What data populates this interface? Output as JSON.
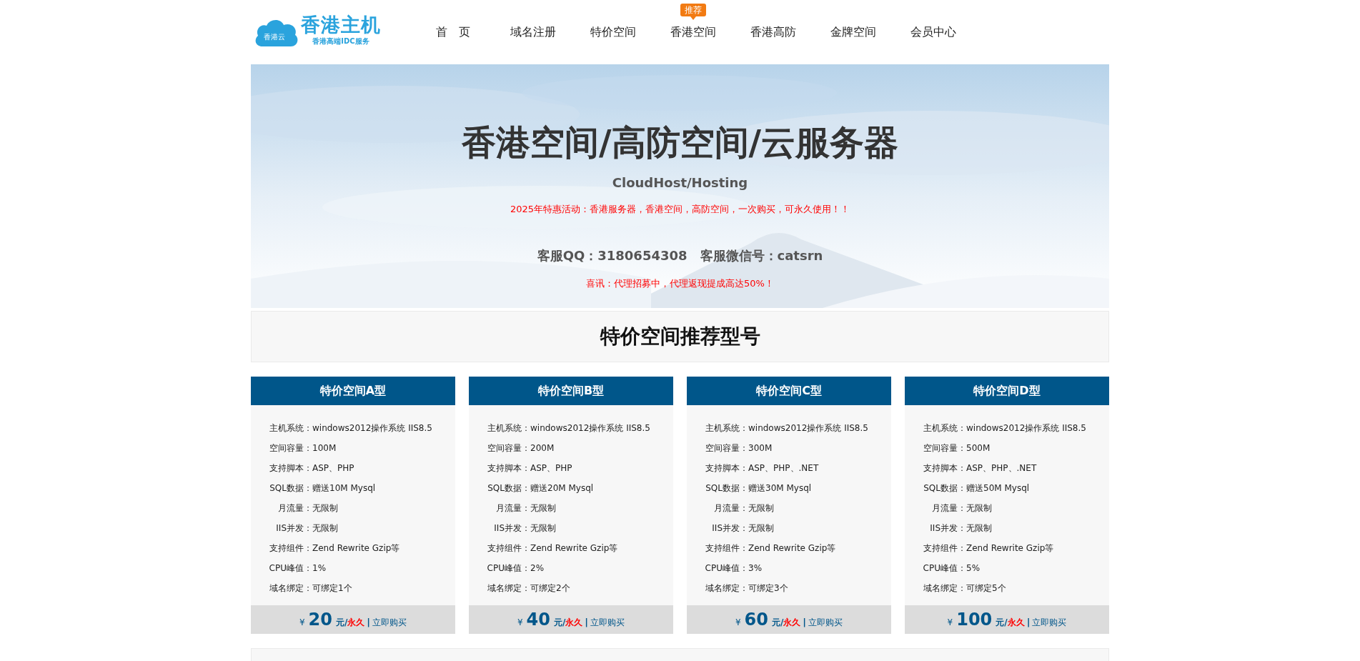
{
  "logo": {
    "badge": "香港云",
    "title": "香港主机",
    "subtitle": "香港高端IDC服务"
  },
  "nav": [
    {
      "label": "首　页"
    },
    {
      "label": "域名注册"
    },
    {
      "label": "特价空间"
    },
    {
      "label": "香港空间",
      "badge": "推荐"
    },
    {
      "label": "香港高防"
    },
    {
      "label": "金牌空间"
    },
    {
      "label": "会员中心"
    }
  ],
  "banner": {
    "title": "香港空间/高防空间/云服务器",
    "subtitle": "CloudHost/Hosting",
    "promo": "2025年特惠活动：香港服务器，香港空间，高防空间，一次购买，可永久使用！！",
    "contact": "客服QQ：3180654308　客服微信号：catsrn",
    "notice": "喜讯：代理招募中，代理返现提成高达50%！"
  },
  "section": {
    "title": "特价空间推荐型号"
  },
  "plans": [
    {
      "name": "特价空间A型",
      "specs": [
        {
          "label": "主机系统：",
          "value": "windows2012操作系统 IIS8.5"
        },
        {
          "label": "空间容量：",
          "value": "100M"
        },
        {
          "label": "支持脚本：",
          "value": "ASP、PHP"
        },
        {
          "label": "SQL数据：",
          "value": "赠送10M Mysql"
        },
        {
          "label": "月流量：",
          "value": "无限制"
        },
        {
          "label": "IIS并发：",
          "value": "无限制"
        },
        {
          "label": "支持组件：",
          "value": "Zend Rewrite Gzip等"
        },
        {
          "label": "CPU峰值：",
          "value": "1%"
        },
        {
          "label": "域名绑定：",
          "value": "可绑定1个"
        }
      ],
      "price": {
        "currency": "¥",
        "amount": "20",
        "unit": "元/",
        "term": "永久",
        "separator": "|",
        "buy": "立即购买"
      }
    },
    {
      "name": "特价空间B型",
      "specs": [
        {
          "label": "主机系统：",
          "value": "windows2012操作系统 IIS8.5"
        },
        {
          "label": "空间容量：",
          "value": "200M"
        },
        {
          "label": "支持脚本：",
          "value": "ASP、PHP"
        },
        {
          "label": "SQL数据：",
          "value": "赠送20M Mysql"
        },
        {
          "label": "月流量：",
          "value": "无限制"
        },
        {
          "label": "IIS并发：",
          "value": "无限制"
        },
        {
          "label": "支持组件：",
          "value": "Zend Rewrite Gzip等"
        },
        {
          "label": "CPU峰值：",
          "value": "2%"
        },
        {
          "label": "域名绑定：",
          "value": "可绑定2个"
        }
      ],
      "price": {
        "currency": "¥",
        "amount": "40",
        "unit": "元/",
        "term": "永久",
        "separator": "|",
        "buy": "立即购买"
      }
    },
    {
      "name": "特价空间C型",
      "specs": [
        {
          "label": "主机系统：",
          "value": "windows2012操作系统 IIS8.5"
        },
        {
          "label": "空间容量：",
          "value": "300M"
        },
        {
          "label": "支持脚本：",
          "value": "ASP、PHP、.NET"
        },
        {
          "label": "SQL数据：",
          "value": "赠送30M Mysql"
        },
        {
          "label": "月流量：",
          "value": "无限制"
        },
        {
          "label": "IIS并发：",
          "value": "无限制"
        },
        {
          "label": "支持组件：",
          "value": "Zend Rewrite Gzip等"
        },
        {
          "label": "CPU峰值：",
          "value": "3%"
        },
        {
          "label": "域名绑定：",
          "value": "可绑定3个"
        }
      ],
      "price": {
        "currency": "¥",
        "amount": "60",
        "unit": "元/",
        "term": "永久",
        "separator": "|",
        "buy": "立即购买"
      }
    },
    {
      "name": "特价空间D型",
      "specs": [
        {
          "label": "主机系统：",
          "value": "windows2012操作系统 IIS8.5"
        },
        {
          "label": "空间容量：",
          "value": "500M"
        },
        {
          "label": "支持脚本：",
          "value": "ASP、PHP、.NET"
        },
        {
          "label": "SQL数据：",
          "value": "赠送50M Mysql"
        },
        {
          "label": "月流量：",
          "value": "无限制"
        },
        {
          "label": "IIS并发：",
          "value": "无限制"
        },
        {
          "label": "支持组件：",
          "value": "Zend Rewrite Gzip等"
        },
        {
          "label": "CPU峰值：",
          "value": "5%"
        },
        {
          "label": "域名绑定：",
          "value": "可绑定5个"
        }
      ],
      "price": {
        "currency": "¥",
        "amount": "100",
        "unit": "元/",
        "term": "永久",
        "separator": "|",
        "buy": "立即购买"
      }
    }
  ]
}
